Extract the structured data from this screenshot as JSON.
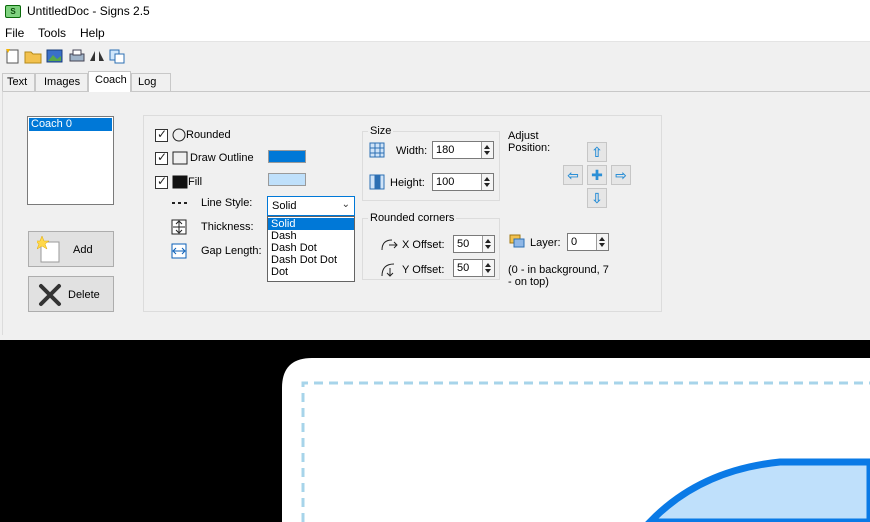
{
  "window": {
    "title": "UntitledDoc - Signs 2.5",
    "app_icon_text": "S"
  },
  "menu": {
    "items": [
      "File",
      "Tools",
      "Help"
    ]
  },
  "toolbar": {
    "icons": [
      "new-file-icon",
      "open-folder-icon",
      "image-icon",
      "print-icon",
      "mirror-icon",
      "copy-icon"
    ]
  },
  "tabs": [
    "Text",
    "Images",
    "Coach",
    "Log"
  ],
  "active_tab": "Coach",
  "coach_list": {
    "items": [
      "Coach 0"
    ],
    "selected": "Coach 0"
  },
  "buttons": {
    "add": "Add",
    "delete": "Delete"
  },
  "shape": {
    "rounded_label": "Rounded",
    "draw_outline_label": "Draw Outline",
    "fill_label": "Fill",
    "outline_color": "#0078d7",
    "fill_color": "#bfe0fb",
    "line_style_label": "Line Style:",
    "line_style_value": "Solid",
    "line_style_options": [
      "Solid",
      "Dash",
      "Dash Dot",
      "Dash Dot Dot",
      "Dot"
    ],
    "thickness_label": "Thickness:",
    "gap_length_label": "Gap Length:"
  },
  "size": {
    "title": "Size",
    "width_label": "Width:",
    "width_value": "180",
    "height_label": "Height:",
    "height_value": "100"
  },
  "rounded_corners": {
    "title": "Rounded corners",
    "x_label": "X Offset:",
    "x_value": "50",
    "y_label": "Y Offset:",
    "y_value": "50"
  },
  "adjust": {
    "label": "Adjust Position:"
  },
  "layer": {
    "label": "Layer:",
    "value": "0",
    "hint": "(0 - in background, 7 - on top)"
  },
  "canvas": {
    "background": "#000000",
    "coach_outline_color": "#a7d4ea",
    "shape_color": "#bfe0fb",
    "shape_outline": "#0a7ae6"
  }
}
